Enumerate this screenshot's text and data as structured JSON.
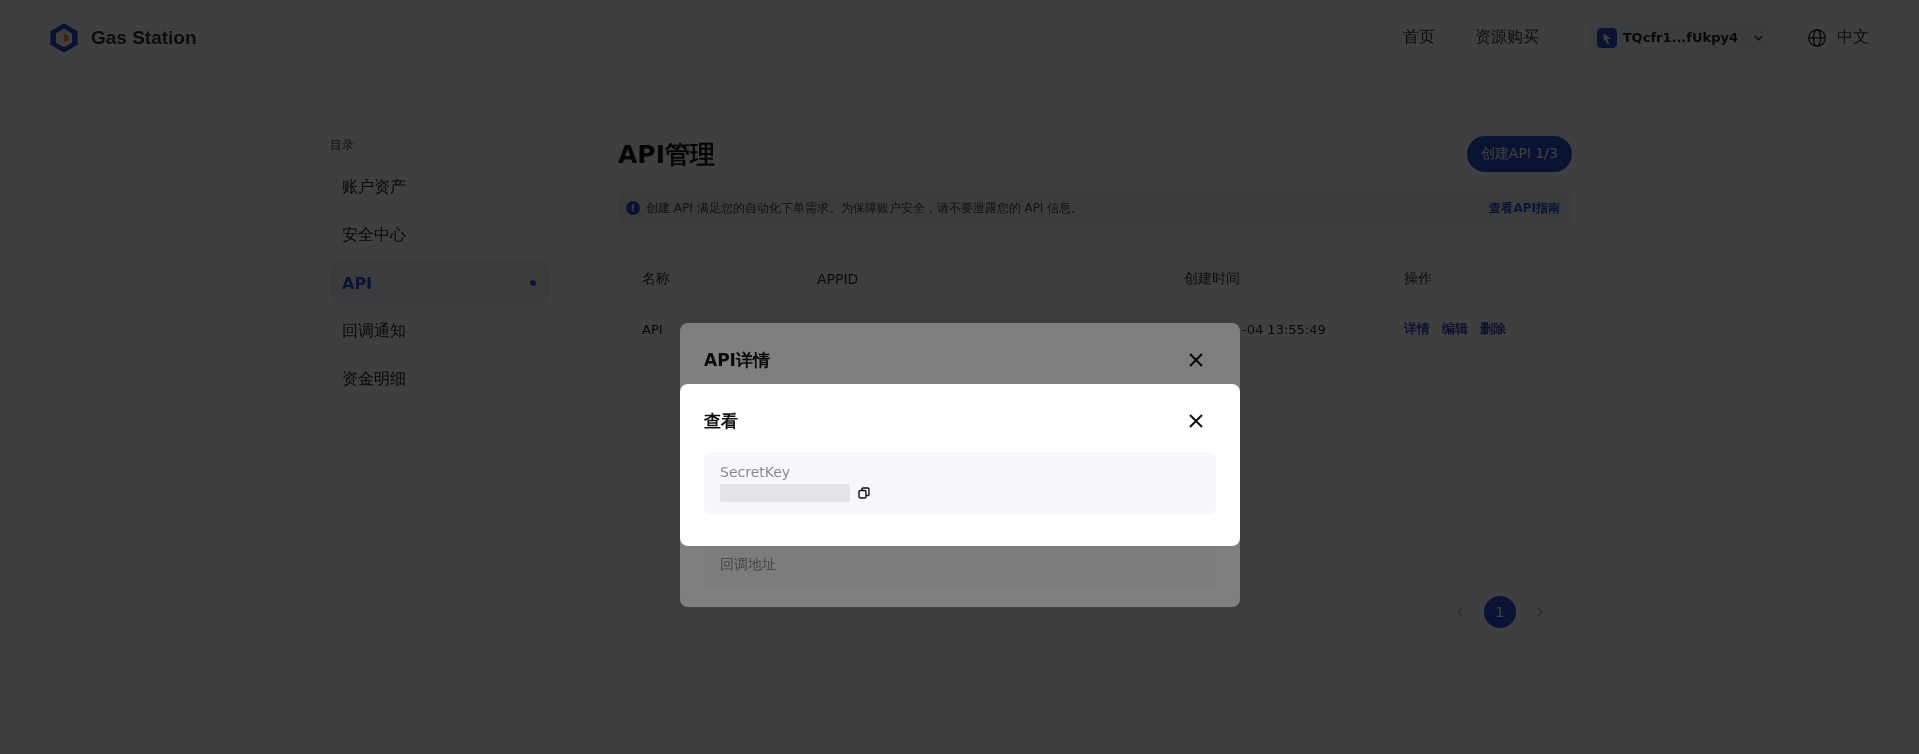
{
  "header": {
    "logo_text": "Gas Station",
    "nav": [
      {
        "label": "首页"
      },
      {
        "label": "资源购买"
      }
    ],
    "wallet": "TQcfr1...fUkpy4",
    "language": "中文"
  },
  "sidebar": {
    "heading": "目录",
    "items": [
      {
        "label": "账户资产",
        "selected": false
      },
      {
        "label": "安全中心",
        "selected": false
      },
      {
        "label": "API",
        "selected": true
      },
      {
        "label": "回调通知",
        "selected": false
      },
      {
        "label": "资金明细",
        "selected": false
      }
    ]
  },
  "main": {
    "title": "API管理",
    "create_button": "创建API 1/3",
    "notice": {
      "text": "创建 API 满足您的自动化下单需求。为保障账户安全，请不要泄露您的 API 信息。",
      "link": "查看API指南"
    },
    "table": {
      "columns": [
        "名称",
        "APPID",
        "创建时间",
        "操作"
      ],
      "rows": [
        {
          "name": "API",
          "created": "-04 13:55:49",
          "actions": [
            "详情",
            "编辑",
            "删除"
          ]
        }
      ]
    },
    "pagination": {
      "pages": [
        {
          "label": "1",
          "selected": true
        }
      ]
    }
  },
  "dialogs": [
    {
      "title": "API详情",
      "fields": [
        {
          "label": "回调地址"
        }
      ]
    },
    {
      "title": "查看",
      "fields": [
        {
          "label": "SecretKey",
          "value_hidden": true,
          "copyable": true
        }
      ]
    }
  ]
}
